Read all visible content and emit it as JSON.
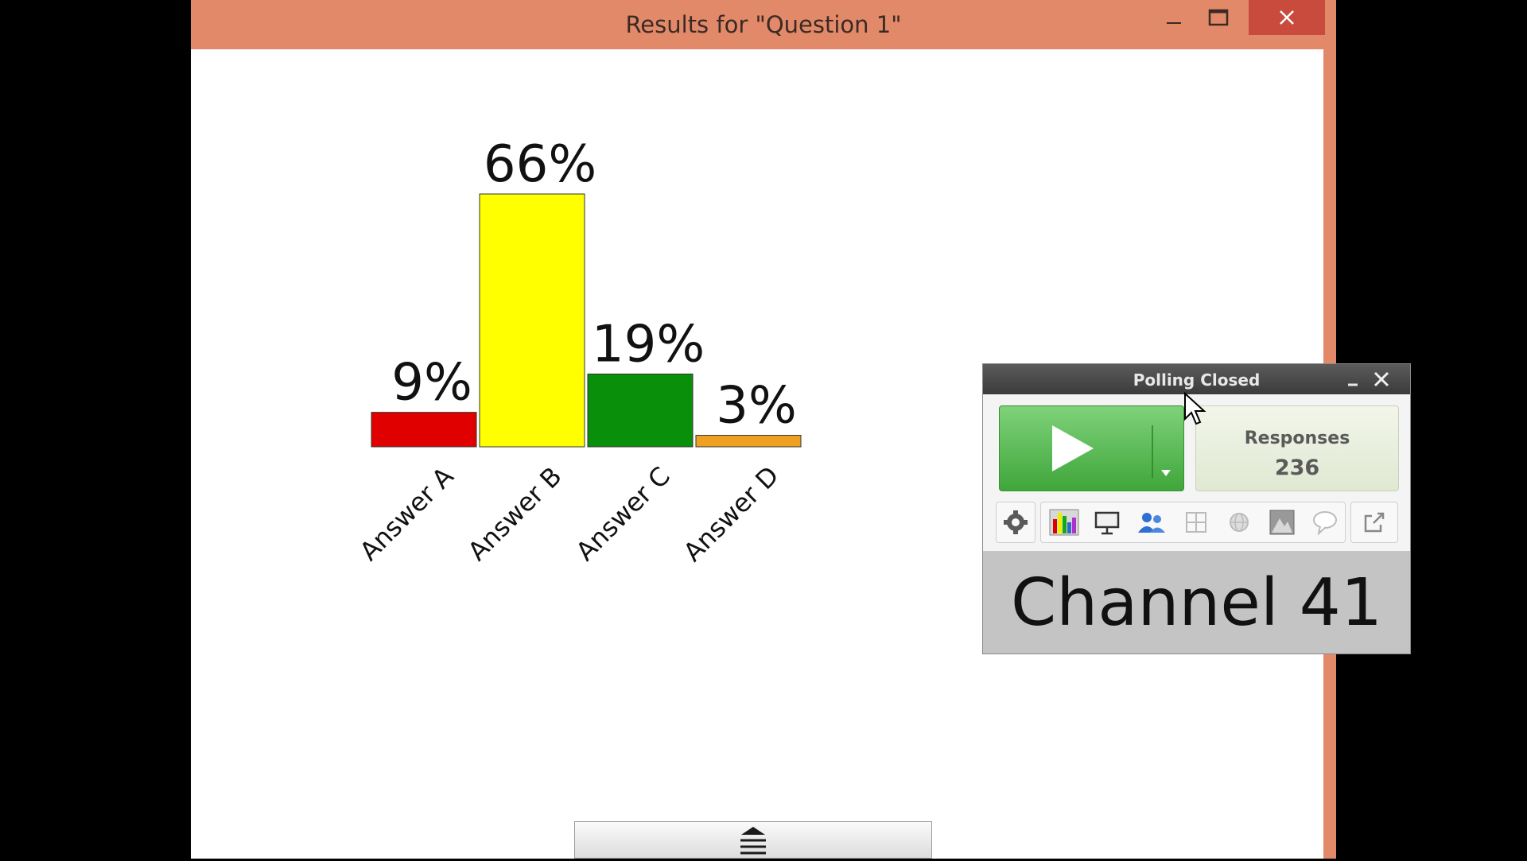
{
  "window": {
    "title": "Results for \"Question 1\"",
    "titlebar_color": "#e2896a",
    "close_color": "#c94b3e"
  },
  "chart_data": {
    "type": "bar",
    "categories": [
      "Answer A",
      "Answer B",
      "Answer C",
      "Answer D"
    ],
    "values": [
      9,
      66,
      19,
      3
    ],
    "value_labels": [
      "9%",
      "66%",
      "19%",
      "3%"
    ],
    "colors": [
      "#e00000",
      "#ffff00",
      "#0a8f0a",
      "#f0a020"
    ],
    "ylim": [
      0,
      66
    ]
  },
  "polling": {
    "title": "Polling Closed",
    "responses_label": "Responses",
    "responses_count": "236",
    "channel": "Channel 41",
    "toolbar_icons": [
      "gear-icon",
      "bar-chart-icon",
      "presentation-icon",
      "participants-icon",
      "grid-icon",
      "globe-icon",
      "image-icon",
      "speech-bubble-icon",
      "export-icon"
    ],
    "play_color": "#4cb847"
  },
  "drawer": {
    "icon": "eject-menu-icon"
  }
}
